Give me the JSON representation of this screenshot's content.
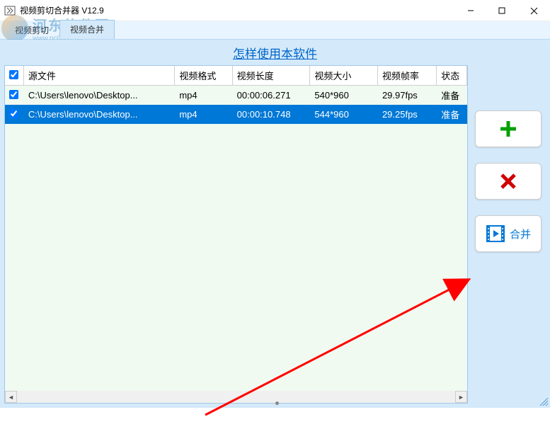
{
  "window": {
    "title": "视频剪切合并器 V12.9"
  },
  "tabs": {
    "cut": "视频剪切",
    "merge": "视频合并"
  },
  "help_link": "怎样使用本软件",
  "table": {
    "headers": {
      "source": "源文件",
      "format": "视频格式",
      "duration": "视频长度",
      "size": "视频大小",
      "fps": "视频帧率",
      "status": "状态"
    },
    "rows": [
      {
        "checked": true,
        "source": "C:\\Users\\lenovo\\Desktop...",
        "format": "mp4",
        "duration": "00:00:06.271",
        "size": "540*960",
        "fps": "29.97fps",
        "status": "准备",
        "selected": false
      },
      {
        "checked": true,
        "source": "C:\\Users\\lenovo\\Desktop...",
        "format": "mp4",
        "duration": "00:00:10.748",
        "size": "544*960",
        "fps": "29.25fps",
        "status": "准备",
        "selected": true
      }
    ]
  },
  "buttons": {
    "merge": "合并"
  },
  "watermark": {
    "brand": "河东软件园",
    "url": "www.pc0359.cn"
  },
  "icons": {
    "plus": "plus-icon",
    "delete": "delete-icon",
    "merge": "merge-icon"
  }
}
